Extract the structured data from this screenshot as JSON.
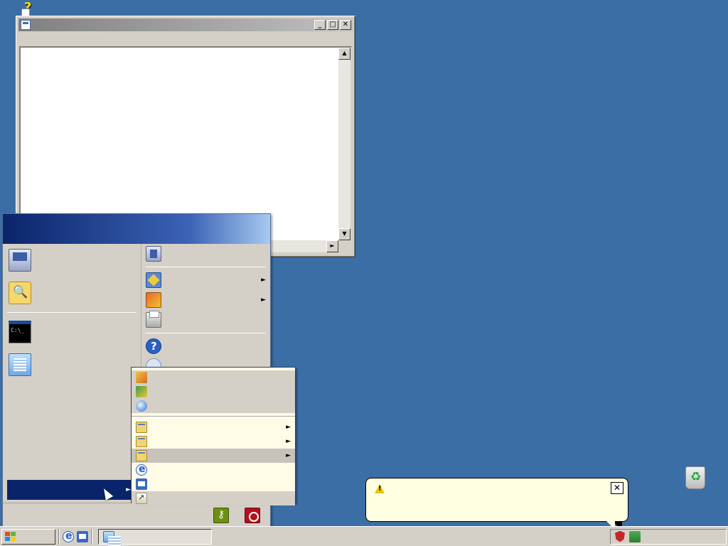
{
  "desktop": {
    "help_icon_label": "",
    "recycle_bin_label": ""
  },
  "window": {
    "title": "",
    "buttons": {
      "minimize": "_",
      "maximize": "□",
      "close": "✕"
    },
    "menu": [
      "",
      "",
      "",
      "",
      ""
    ],
    "editor_text": "",
    "scroll": {
      "up": "▲",
      "down": "▼",
      "right": "►"
    }
  },
  "start_menu": {
    "user_name": "",
    "pinned": [
      {
        "label": "",
        "icon": "computer-icon"
      },
      {
        "label": "",
        "icon": "search-icon"
      }
    ],
    "recent": [
      {
        "label": "",
        "icon": "command-prompt-icon"
      },
      {
        "label": "",
        "icon": "notepad-icon"
      }
    ],
    "right_items": [
      {
        "label": "",
        "icon": "computer-icon",
        "arrow": false
      },
      {
        "label": "",
        "icon": "control-panel-icon",
        "arrow": true
      },
      {
        "label": "",
        "icon": "programs-icon",
        "arrow": true
      },
      {
        "label": "",
        "icon": "printer-icon",
        "arrow": false
      },
      {
        "label": "",
        "icon": "help-icon",
        "arrow": false
      },
      {
        "label": "",
        "icon": "run-icon",
        "arrow": false
      }
    ],
    "all_programs": "",
    "all_programs_arrow": "►",
    "log_off": "",
    "shut_down": ""
  },
  "submenu": {
    "top_items": [
      {
        "label": "",
        "icon": "app-icon"
      },
      {
        "label": "",
        "icon": "app-icon"
      },
      {
        "label": "",
        "icon": "app-icon"
      }
    ],
    "folder_items": [
      {
        "label": "",
        "arrow": "►"
      },
      {
        "label": "",
        "arrow": "►"
      },
      {
        "label": "",
        "arrow": "►"
      }
    ],
    "app_items": [
      {
        "label": "",
        "icon": "internet-explorer-icon"
      },
      {
        "label": "",
        "icon": "outlook-express-icon"
      },
      {
        "label": "",
        "icon": "assistance-icon"
      }
    ]
  },
  "balloon": {
    "title": "",
    "text": "",
    "close": "✕"
  },
  "taskbar": {
    "start_label": "",
    "task_button_label": "",
    "tray_text": ""
  },
  "colors": {
    "desktop": "#3a6ea5",
    "start_header": "#0a246a",
    "balloon": "#ffffe1"
  }
}
